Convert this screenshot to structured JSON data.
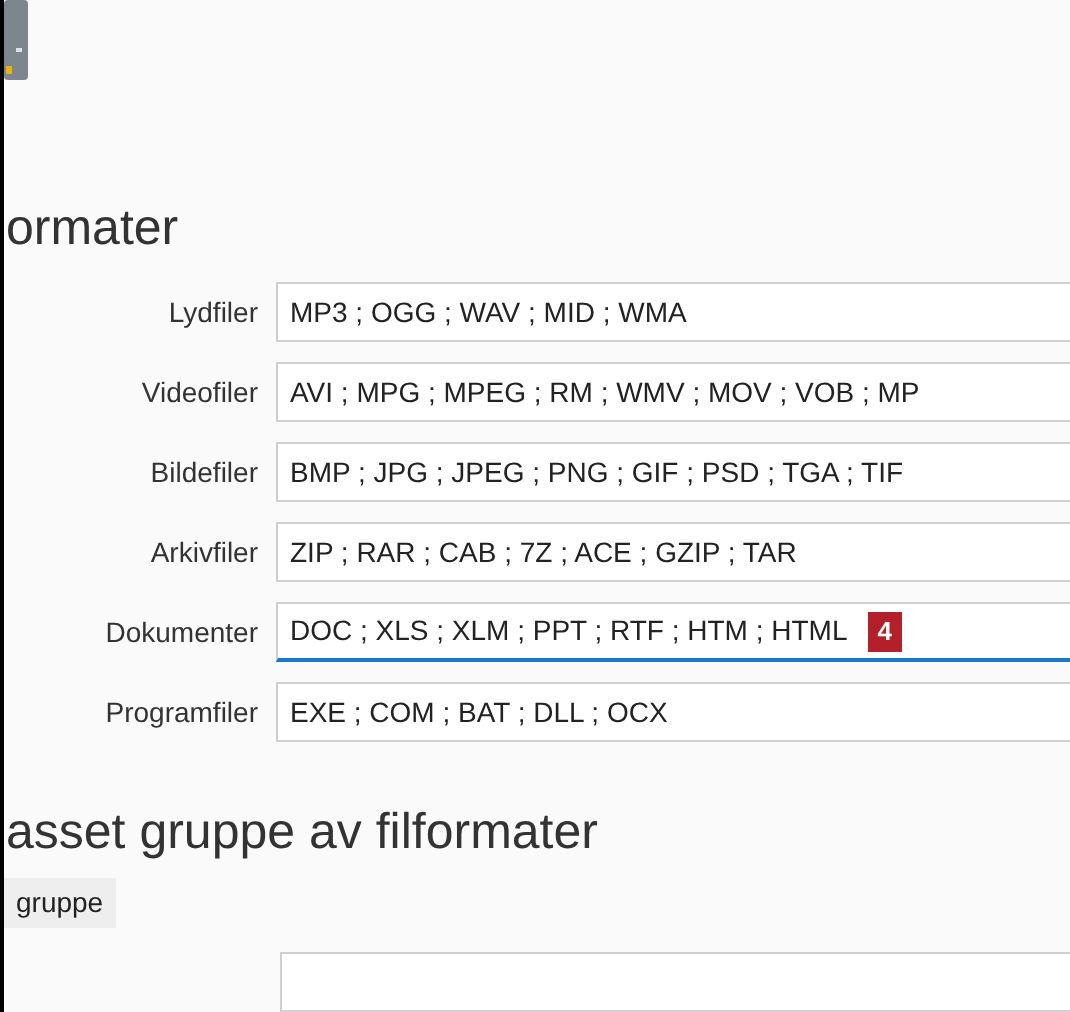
{
  "section_title": "ormater",
  "fields": [
    {
      "label": "Lydfiler",
      "value": "MP3 ; OGG ; WAV ; MID ; WMA",
      "focused": false
    },
    {
      "label": "Videofiler",
      "value": "AVI ; MPG ; MPEG ; RM ; WMV ; MOV ; VOB ; MP",
      "focused": false
    },
    {
      "label": "Bildefiler",
      "value": "BMP ; JPG ; JPEG ; PNG ; GIF ; PSD ; TGA ; TIF",
      "focused": false
    },
    {
      "label": "Arkivfiler",
      "value": "ZIP ; RAR ; CAB ; 7Z ; ACE ; GZIP ; TAR",
      "focused": false
    },
    {
      "label": "Dokumenter",
      "value": "DOC ; XLS ; XLM ; PPT ; RTF ; HTM ; HTML",
      "focused": true,
      "badge": "4"
    },
    {
      "label": "Programfiler",
      "value": "EXE ; COM ; BAT ; DLL ; OCX",
      "focused": false
    }
  ],
  "custom_section_title": "asset gruppe av filformater",
  "group_tab": "gruppe"
}
